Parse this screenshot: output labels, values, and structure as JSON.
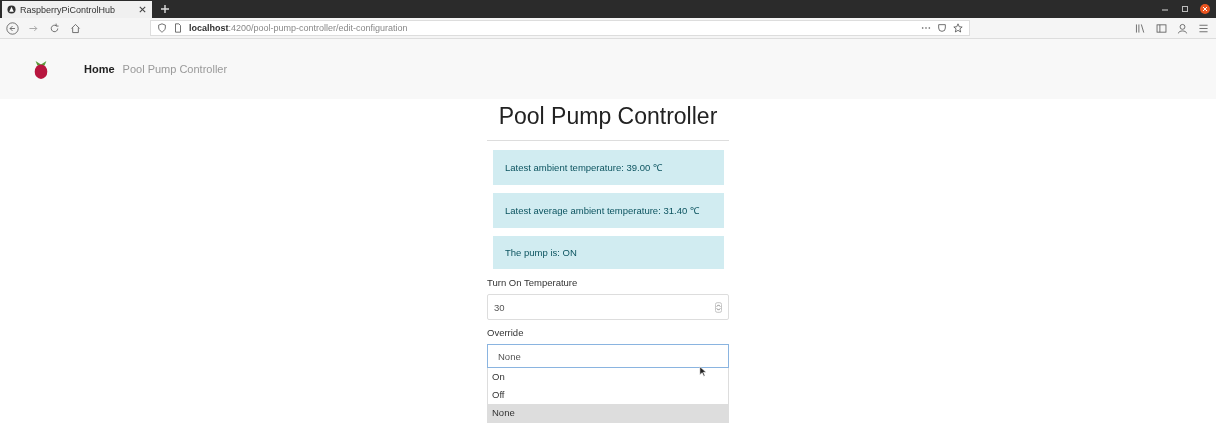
{
  "browser": {
    "tab_title": "RaspberryPiControlHub",
    "url": "**localhost**:4200/pool-pump-controller/edit-configuration"
  },
  "nav": {
    "items": [
      {
        "label": "Home",
        "selected": true
      },
      {
        "label": "Pool Pump Controller",
        "selected": false
      }
    ]
  },
  "page": {
    "title": "Pool Pump Controller",
    "alerts": [
      "Latest ambient temperature: 39.00 ℃",
      "Latest average ambient temperature: 31.40 ℃",
      "The pump is: ON"
    ],
    "turn_on_temperature": {
      "label": "Turn On Temperature",
      "value": "30"
    },
    "override": {
      "label": "Override",
      "value": "None",
      "expanded": true,
      "options": [
        {
          "label": "On",
          "selected": false
        },
        {
          "label": "Off",
          "selected": false
        },
        {
          "label": "None",
          "selected": true
        }
      ]
    }
  }
}
